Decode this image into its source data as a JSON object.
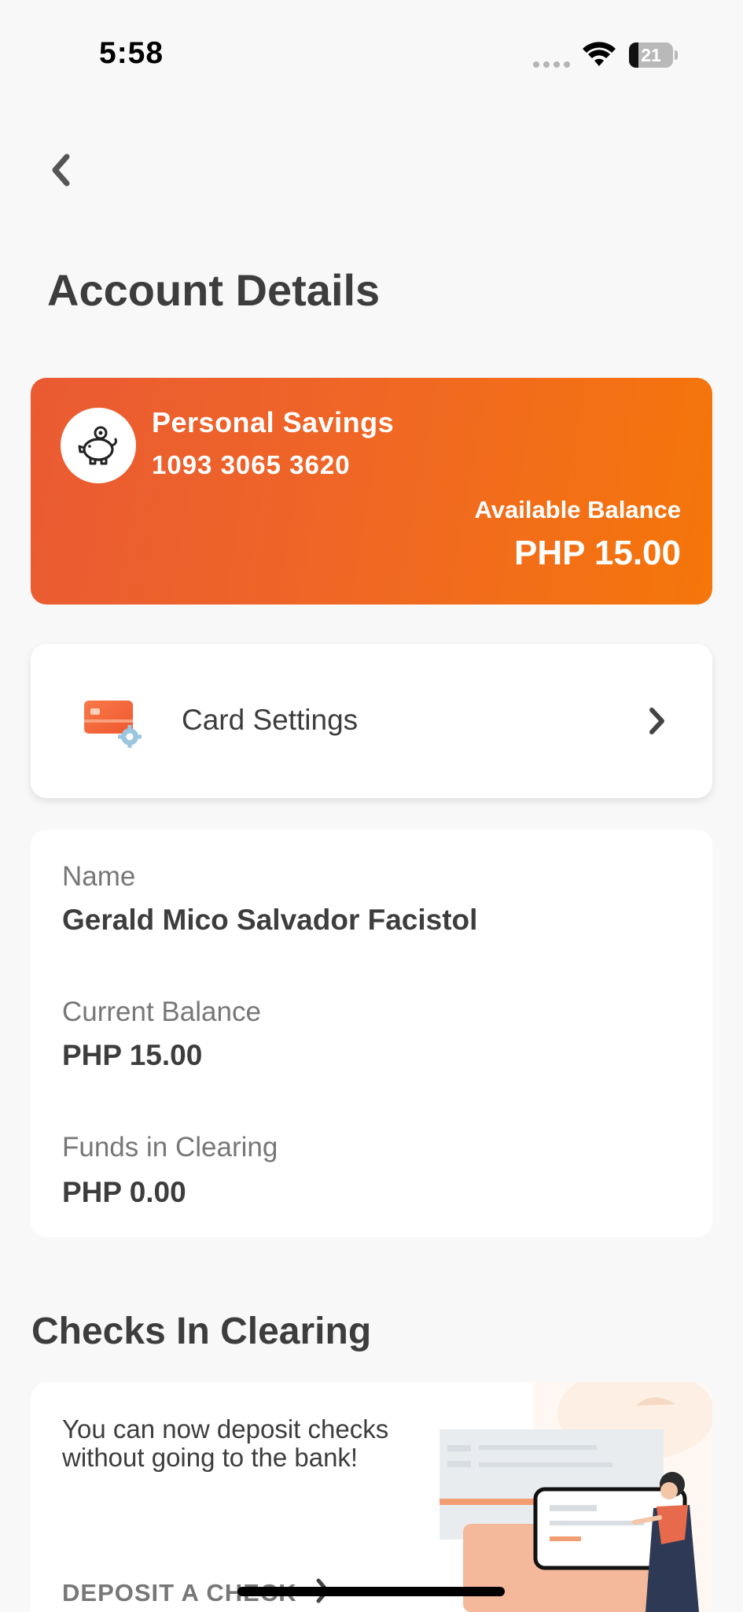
{
  "status_bar": {
    "time": "5:58",
    "battery_level": "21"
  },
  "page": {
    "title": "Account Details"
  },
  "account": {
    "name": "Personal Savings",
    "number": "1093 3065 3620",
    "balance_label": "Available Balance",
    "balance_value": "PHP 15.00"
  },
  "card_settings": {
    "label": "Card Settings"
  },
  "details": [
    {
      "label": "Name",
      "value": "Gerald Mico Salvador Facistol"
    },
    {
      "label": "Current Balance",
      "value": "PHP 15.00"
    },
    {
      "label": "Funds in Clearing",
      "value": "PHP 0.00"
    }
  ],
  "checks": {
    "section_title": "Checks In Clearing",
    "promo_text": "You can now deposit checks without going to the bank!",
    "link_label": "DEPOSIT A CHECK"
  },
  "icons": {
    "back": "chevron-left-icon",
    "account": "piggy-bank-icon",
    "card_settings": "card-settings-icon",
    "arrow": "chevron-right-icon"
  },
  "colors": {
    "brand_orange_start": "#ea5a33",
    "brand_orange_end": "#f5760a",
    "text_dark": "#3d3d3d",
    "text_muted": "#777777",
    "background": "#f8f8f8"
  }
}
